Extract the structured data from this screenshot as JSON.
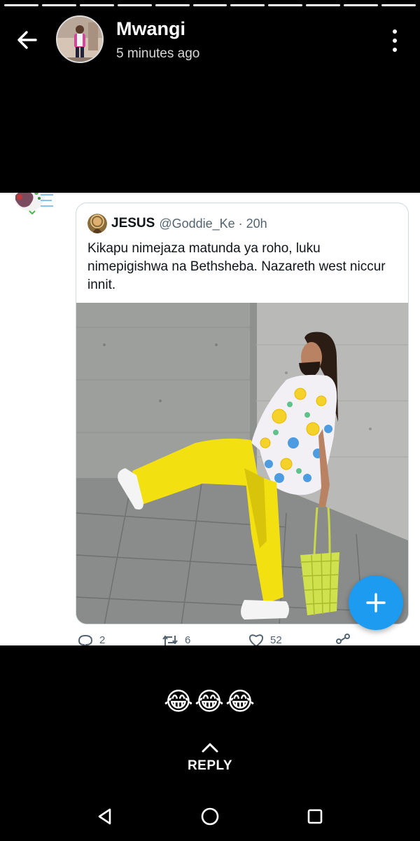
{
  "progress": {
    "segments": 11
  },
  "header": {
    "name": "Mwangi",
    "time": "5 minutes ago",
    "back_icon": "arrow-left-icon",
    "menu_icon": "more-vertical-icon"
  },
  "tweet": {
    "quoted": {
      "author_name": "JESUS",
      "handle_time": "@Goddie_Ke · 20h",
      "text": "Kikapu nimejaza matunda ya roho, luku nimepigishwa na Bethsheba. Nazareth west niccur innit."
    },
    "actions": {
      "replies": "2",
      "retweets": "6",
      "likes": "52"
    },
    "compose_icon": "plus-icon"
  },
  "reply": {
    "emojis": "😂😂😂",
    "label": "REPLY"
  },
  "colors": {
    "twitter_blue": "#1d9bf0",
    "background": "#000000",
    "card": "#ffffff"
  }
}
